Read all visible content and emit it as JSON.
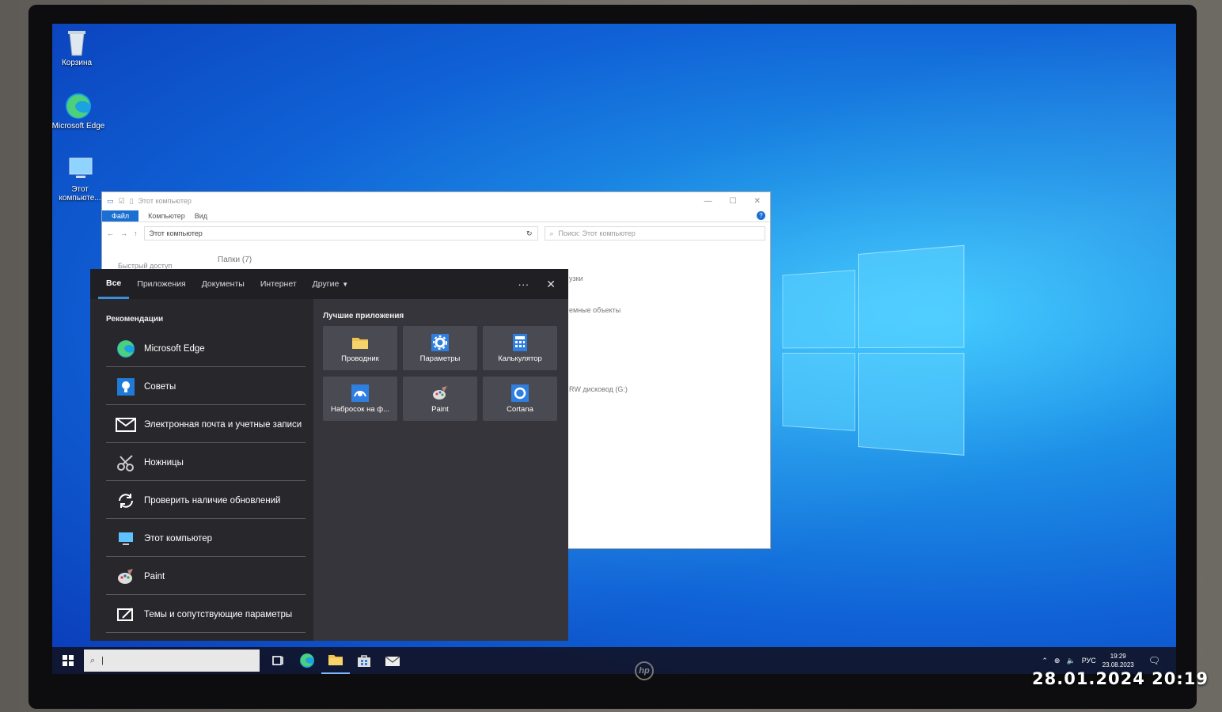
{
  "desktop": {
    "icons": [
      {
        "label": "Корзина",
        "icon": "recycle-bin-icon"
      },
      {
        "label": "Microsoft Edge",
        "icon": "edge-icon"
      },
      {
        "label": "Этот компьюте...",
        "icon": "this-pc-icon"
      }
    ]
  },
  "explorer": {
    "title": "Этот компьютер",
    "ribbon": {
      "file": "Файл",
      "computer": "Компьютер",
      "view": "Вид"
    },
    "address": "Этот компьютер",
    "search_placeholder": "Поиск: Этот компьютер",
    "quick_access": "Быстрый доступ",
    "folders_group": "Папки (7)",
    "partial_items": [
      "узки",
      "емные объекты",
      "RW дисковод (G:)"
    ]
  },
  "search_panel": {
    "tabs": [
      "Все",
      "Приложения",
      "Документы",
      "Интернет",
      "Другие"
    ],
    "active_tab": "Все",
    "more_label": "···",
    "recommendations_header": "Рекомендации",
    "recommendations": [
      {
        "label": "Microsoft Edge",
        "icon": "edge-icon"
      },
      {
        "label": "Советы",
        "icon": "tips-icon"
      },
      {
        "label": "Электронная почта и учетные записи",
        "icon": "mail-icon"
      },
      {
        "label": "Ножницы",
        "icon": "scissors-icon"
      },
      {
        "label": "Проверить наличие обновлений",
        "icon": "update-icon"
      },
      {
        "label": "Этот компьютер",
        "icon": "this-pc-icon"
      },
      {
        "label": "Paint",
        "icon": "paint-icon"
      },
      {
        "label": "Темы и сопутствующие параметры",
        "icon": "themes-icon"
      }
    ],
    "top_apps_header": "Лучшие приложения",
    "top_apps": [
      {
        "label": "Проводник",
        "icon": "folder-icon",
        "color": "#f2c14e"
      },
      {
        "label": "Параметры",
        "icon": "gear-icon",
        "color": "#2f7fe0"
      },
      {
        "label": "Калькулятор",
        "icon": "calculator-icon",
        "color": "#2f7fe0"
      },
      {
        "label": "Набросок на ф...",
        "icon": "snip-sketch-icon",
        "color": "#2f7fe0"
      },
      {
        "label": "Paint",
        "icon": "paint-icon",
        "color": "#d9d9d9"
      },
      {
        "label": "Cortana",
        "icon": "cortana-icon",
        "color": "#2f7fe0"
      }
    ]
  },
  "taskbar": {
    "tray_lang": "РУС",
    "time": "19:29",
    "date": "23.08.2023"
  },
  "overlay": {
    "brand": "hp",
    "timestamp": "28.01.2024  20:19"
  }
}
